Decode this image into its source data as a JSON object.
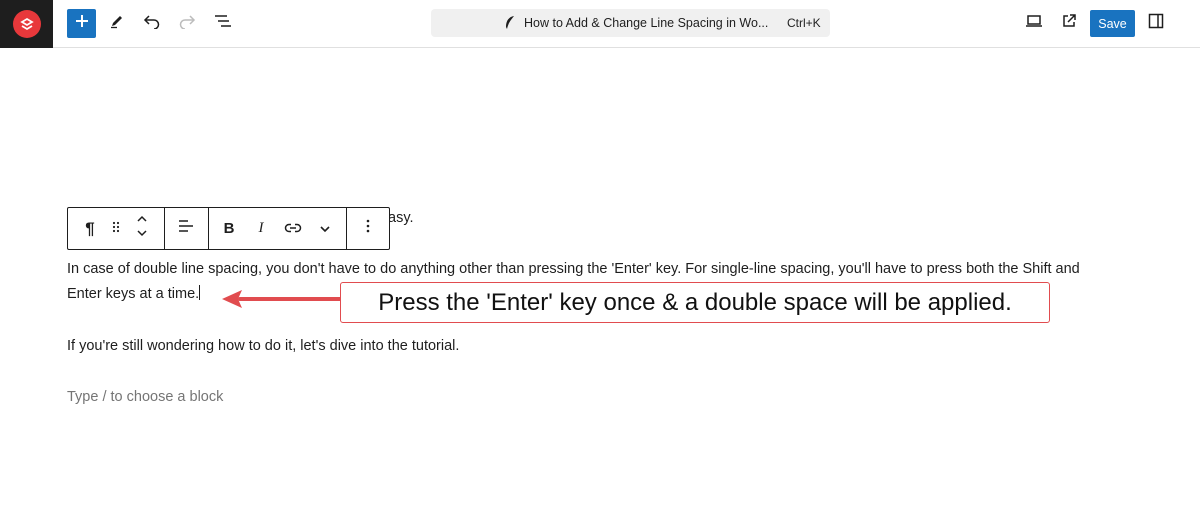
{
  "header": {
    "logo_icon": "site-logo-icon",
    "document_title": "How to Add & Change Line Spacing in Wo...",
    "shortcut": "Ctrl+K",
    "save_label": "Save",
    "icons": [
      "plus-icon",
      "pen-icon",
      "undo-icon",
      "redo-icon",
      "list-view-icon",
      "desktop-preview-icon",
      "external-link-icon",
      "sidebar-toggle-icon",
      "feather-icon"
    ]
  },
  "editor": {
    "partial_text": "asy.",
    "paragraph1_line1": "In case of double line spacing, you don't have to do anything other than pressing the 'Enter' key. For single-line spacing, you'll have to press both the Shift and",
    "paragraph1_line2": "Enter keys at a time.",
    "paragraph2": "If you're still wondering how to do it, let's dive into the tutorial.",
    "placeholder": "Type / to choose a block"
  },
  "block_toolbar": {
    "buttons": [
      "paragraph-icon",
      "drag-handle-icon",
      "move-up-down-icon",
      "align-icon",
      "bold-icon",
      "italic-icon",
      "link-icon",
      "chevron-down-icon",
      "more-options-icon"
    ],
    "bold_label": "B",
    "italic_label": "I",
    "paragraph_label": "¶"
  },
  "annotation": {
    "text": "Press the 'Enter' key once & a double space will be applied.",
    "color": "#e14c4f"
  },
  "colors": {
    "accent": "#1973c0",
    "logo_bg": "#1e1e1e",
    "logo_badge": "#e8383b"
  }
}
